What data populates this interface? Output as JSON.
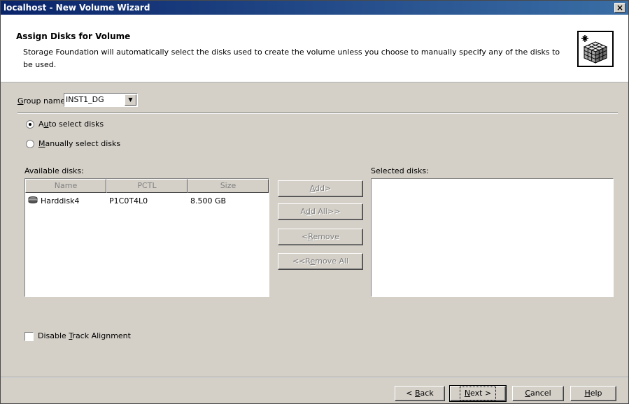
{
  "window": {
    "title": "localhost - New Volume Wizard",
    "close_label": "×"
  },
  "header": {
    "title": "Assign Disks for Volume",
    "description": "Storage Foundation will automatically select the disks used to create the volume unless you choose to manually specify any of the disks to be used."
  },
  "group": {
    "label_prefix": "",
    "label_accel": "G",
    "label_rest": "roup name:",
    "value": "INST1_DG",
    "arrow": "▼"
  },
  "selection_mode": {
    "auto": {
      "prefix": "A",
      "accel": "u",
      "rest": "to select disks",
      "selected": true
    },
    "manual": {
      "prefix": "",
      "accel": "M",
      "rest": "anually select disks",
      "selected": false
    }
  },
  "available": {
    "label": "Available disks:",
    "columns": [
      "Name",
      "PCTL",
      "Size"
    ],
    "rows": [
      {
        "name": "Harddisk4",
        "pctl": "P1C0T4L0",
        "size": "8.500 GB"
      }
    ]
  },
  "selected": {
    "label": "Selected disks:"
  },
  "transfer_buttons": {
    "add": {
      "prefix": "",
      "accel": "A",
      "rest": "dd>"
    },
    "add_all": {
      "prefix": "A",
      "accel": "d",
      "rest": "d All>>"
    },
    "remove": {
      "prefix": "<",
      "accel": "R",
      "rest": "emove"
    },
    "remove_all": {
      "prefix": "<<R",
      "accel": "e",
      "rest": "move All"
    }
  },
  "track_alignment": {
    "prefix": "Disable ",
    "accel": "T",
    "rest": "rack Alignment",
    "checked": false
  },
  "footer": {
    "back": {
      "prefix": "< ",
      "accel": "B",
      "rest": "ack"
    },
    "next": {
      "prefix": "",
      "accel": "N",
      "rest": "ext >"
    },
    "cancel": {
      "prefix": "",
      "accel": "C",
      "rest": "ancel"
    },
    "help": {
      "prefix": "",
      "accel": "H",
      "rest": "elp"
    }
  }
}
